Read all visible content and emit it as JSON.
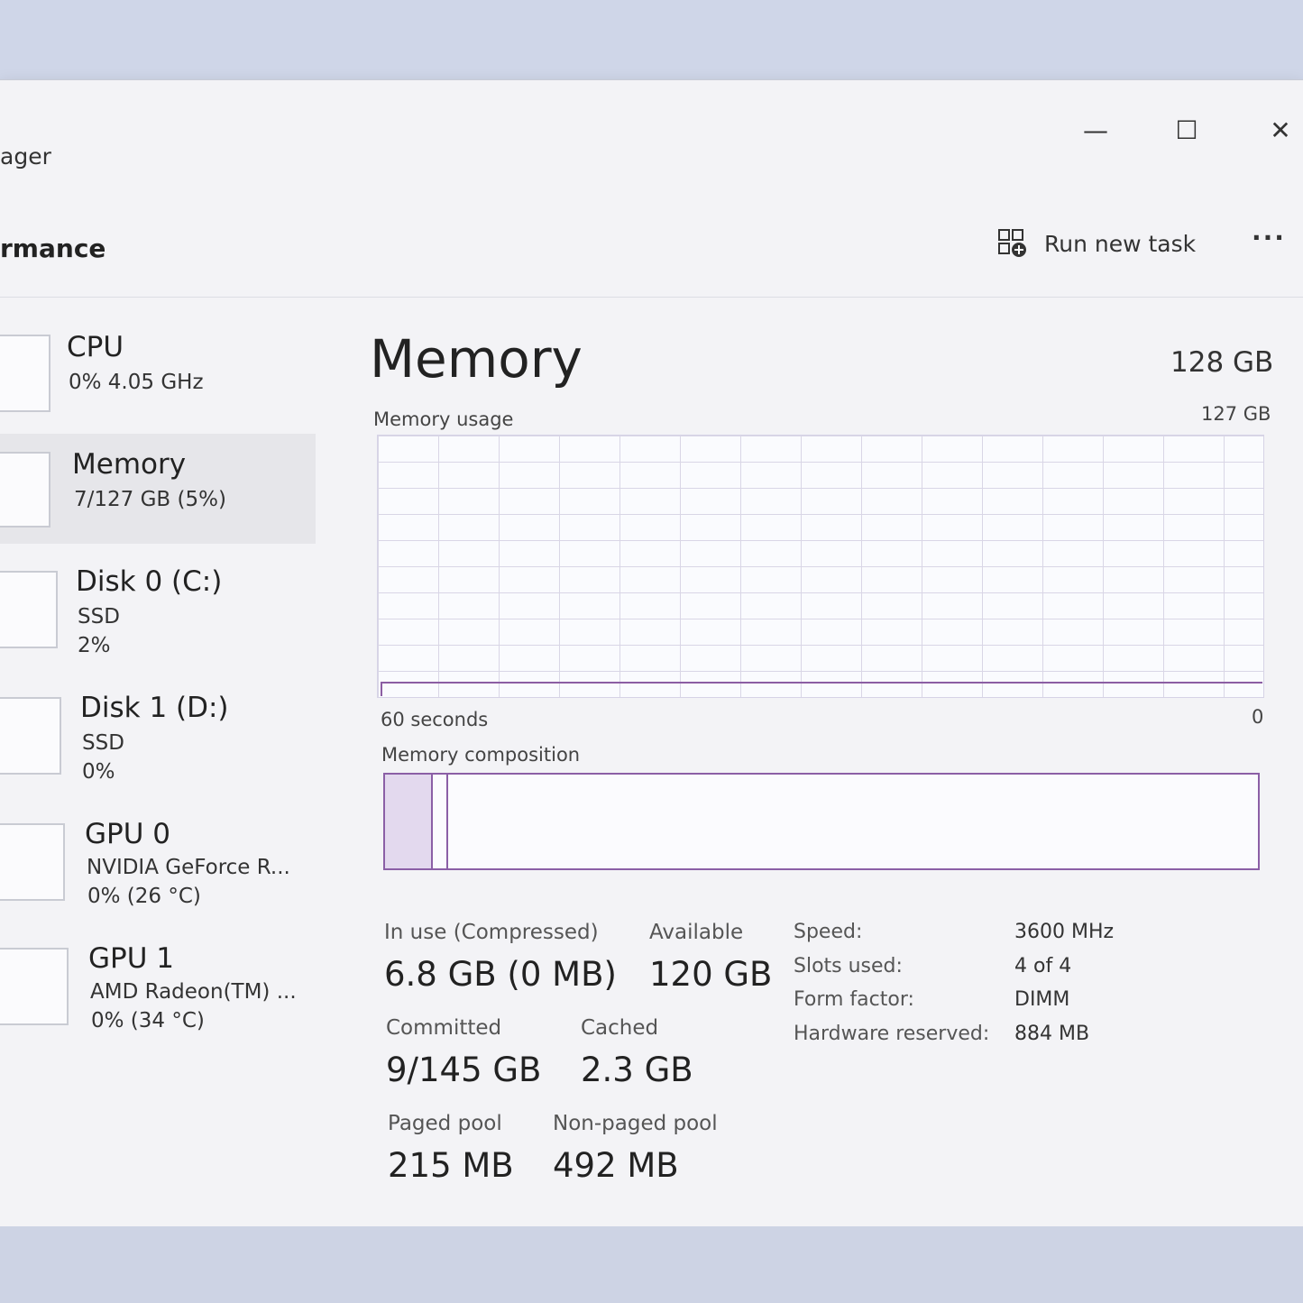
{
  "window": {
    "title": "ager",
    "controls": {
      "minimize": "—",
      "maximize": "☐",
      "close": "✕"
    }
  },
  "header": {
    "title": "rmance",
    "run_new_task": "Run new task",
    "more": "···"
  },
  "sidebar": {
    "items": [
      {
        "name": "CPU",
        "sub1": "0% 4.05 GHz",
        "sub2": "",
        "active": false
      },
      {
        "name": "Memory",
        "sub1": "7/127 GB (5%)",
        "sub2": "",
        "active": true
      },
      {
        "name": "Disk 0 (C:)",
        "sub1": "SSD",
        "sub2": "2%",
        "active": false
      },
      {
        "name": "Disk 1 (D:)",
        "sub1": "SSD",
        "sub2": "0%",
        "active": false
      },
      {
        "name": "GPU 0",
        "sub1": "NVIDIA GeForce R...",
        "sub2": "0% (26 °C)",
        "active": false
      },
      {
        "name": "GPU 1",
        "sub1": "AMD Radeon(TM) ...",
        "sub2": "0% (34 °C)",
        "active": false
      }
    ]
  },
  "main": {
    "title": "Memory",
    "total": "128 GB",
    "usage_label": "Memory usage",
    "usage_max": "127 GB",
    "time_left": "60 seconds",
    "time_right": "0",
    "usage_fraction": 0.05,
    "composition_label": "Memory composition",
    "composition": {
      "in_use_fraction": 0.053,
      "modified_fraction": 0.018
    },
    "stats": {
      "in_use_label": "In use (Compressed)",
      "in_use_value": "6.8 GB (0 MB)",
      "available_label": "Available",
      "available_value": "120 GB",
      "committed_label": "Committed",
      "committed_value": "9/145 GB",
      "cached_label": "Cached",
      "cached_value": "2.3 GB",
      "paged_label": "Paged pool",
      "paged_value": "215 MB",
      "nonpaged_label": "Non-paged pool",
      "nonpaged_value": "492 MB"
    },
    "specs": [
      {
        "label": "Speed:",
        "value": "3600 MHz"
      },
      {
        "label": "Slots used:",
        "value": "4 of 4"
      },
      {
        "label": "Form factor:",
        "value": "DIMM"
      },
      {
        "label": "Hardware reserved:",
        "value": "884 MB"
      }
    ]
  },
  "colors": {
    "accent": "#8b5fa6",
    "accent_fill": "#e3d9ee"
  }
}
